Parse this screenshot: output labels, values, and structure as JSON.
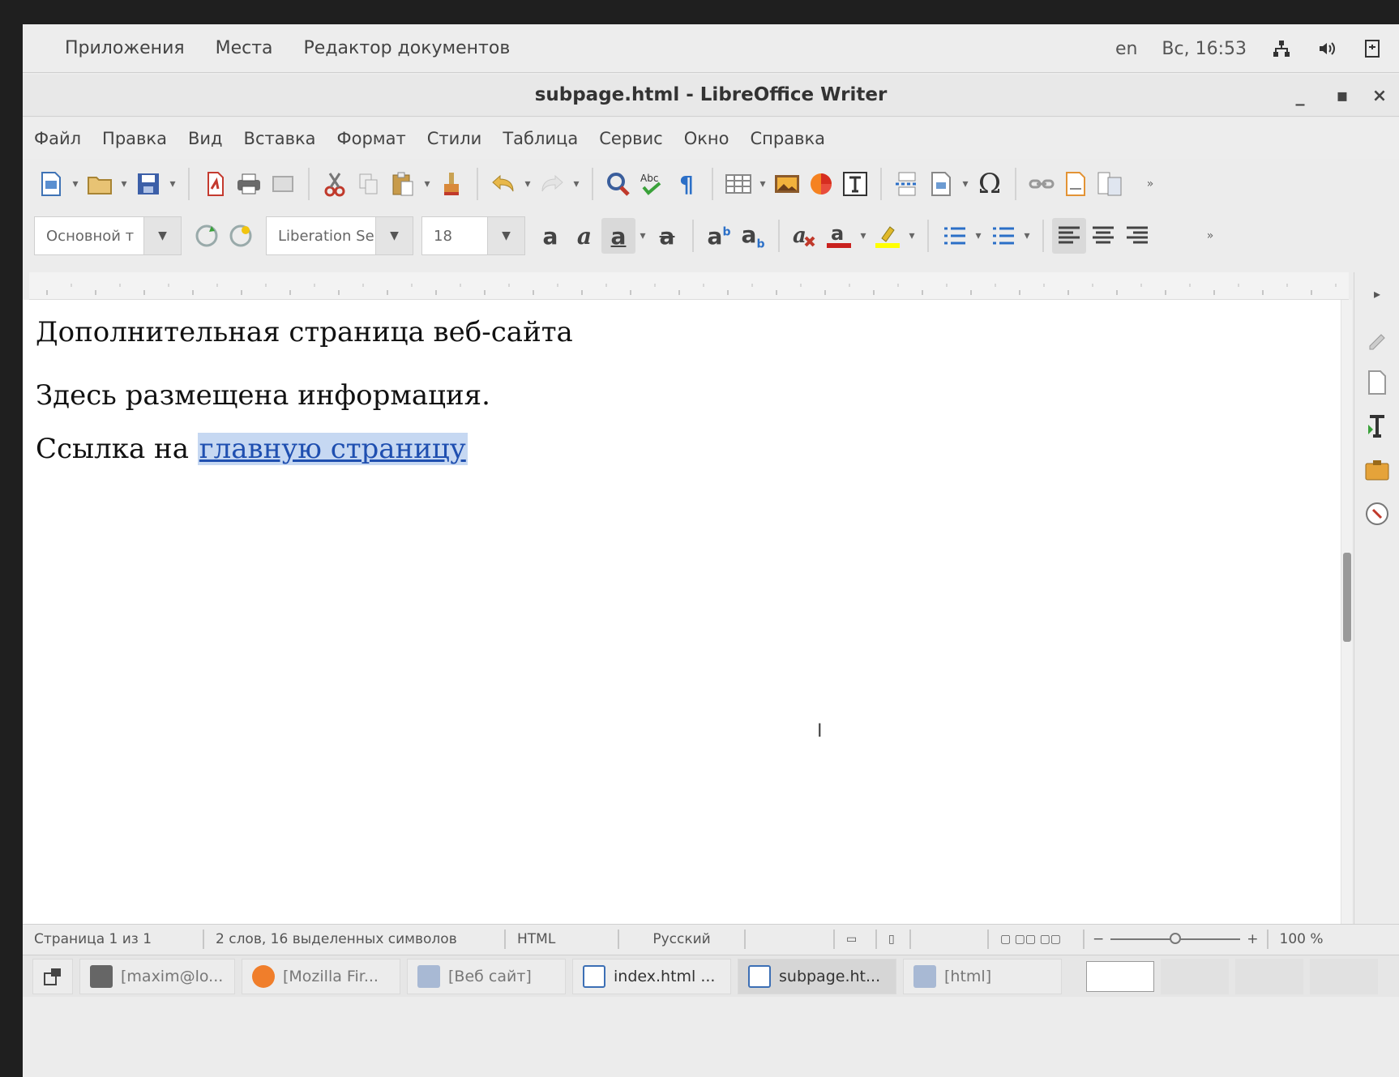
{
  "top_panel": {
    "menu": [
      "Приложения",
      "Места",
      "Редактор документов"
    ],
    "lang": "en",
    "clock": "Вс, 16:53"
  },
  "window": {
    "title": "subpage.html - LibreOffice Writer",
    "minimize": "_",
    "maximize": "▪",
    "close": "×"
  },
  "menubar": [
    "Файл",
    "Правка",
    "Вид",
    "Вставка",
    "Формат",
    "Стили",
    "Таблица",
    "Сервис",
    "Окно",
    "Справка"
  ],
  "formatting": {
    "paragraph_style": "Основной т",
    "font_name": "Liberation Se",
    "font_size": "18"
  },
  "document": {
    "heading": "Дополнительная страница веб-сайта",
    "para1": "Здесь размещена информация.",
    "para2_prefix": "Ссылка на ",
    "para2_link": "главную страницу"
  },
  "statusbar": {
    "page": "Страница 1 из 1",
    "words": "2 слов, 16 выделенных символов",
    "mode": "HTML",
    "language": "Русский",
    "zoom": "100 %",
    "zoom_level": 0.5
  },
  "taskbar": [
    {
      "label": "[maxim@lo...",
      "icon": "terminal-icon"
    },
    {
      "label": "[Mozilla Fir...",
      "icon": "firefox-icon"
    },
    {
      "label": "[Веб сайт]",
      "icon": "folder-icon"
    },
    {
      "label": "index.html ...",
      "icon": "writer-icon"
    },
    {
      "label": "subpage.ht...",
      "icon": "writer-icon"
    },
    {
      "label": "[html]",
      "icon": "folder-icon"
    }
  ]
}
